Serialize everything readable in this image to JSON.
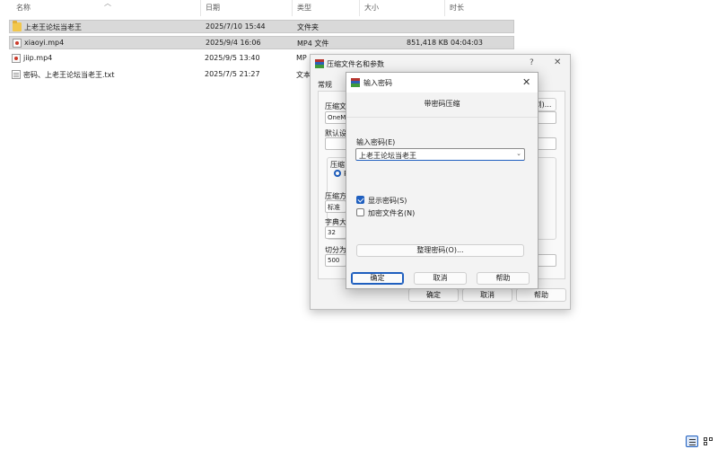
{
  "explorer": {
    "columns": {
      "name": "名称",
      "date": "日期",
      "type": "类型",
      "size": "大小",
      "duration": "时长"
    },
    "files": [
      {
        "name": "上老王论坛当老王",
        "date": "2025/7/10 15:44",
        "type": "文件夹",
        "size": "",
        "duration": "",
        "icon": "folder-icon"
      },
      {
        "name": "xiaoyi.mp4",
        "date": "2025/9/4 16:06",
        "type": "MP4 文件",
        "size": "851,418 KB",
        "duration": "04:04:03",
        "icon": "video-file-icon"
      },
      {
        "name": "jiip.mp4",
        "date": "2025/9/5 13:40",
        "type": "MP",
        "size": "",
        "duration": "",
        "icon": "video-file-icon"
      },
      {
        "name": "密码、上老王论坛当老王.txt",
        "date": "2025/7/5 21:27",
        "type": "文本",
        "size": "",
        "duration": "",
        "icon": "text-file-icon"
      }
    ]
  },
  "archive_dialog": {
    "title": "压缩文件名和参数",
    "help": "?",
    "close": "✕",
    "tab_general": "常规",
    "archive_name_label": "压缩文",
    "archive_name_value": "OneMo",
    "browse_button": "浏)...",
    "default_label": "默认设",
    "format_group_label": "压缩",
    "format_radio_value": "R",
    "method_label": "压缩方",
    "method_value": "标准",
    "dict_label": "字典大",
    "dict_value": "32",
    "split_label": "切分为",
    "split_value": "500",
    "ok_button": "确定",
    "cancel_button": "取消",
    "help_button": "帮助"
  },
  "password_dialog": {
    "title": "输入密码",
    "close": "✕",
    "subtitle": "带密码压缩",
    "password_label": "输入密码(E)",
    "password_value": "上老王论坛当老王",
    "dropdown_arrow": "⌄",
    "show_password_label": "显示密码(S)",
    "show_password_checked": true,
    "encrypt_names_label": "加密文件名(N)",
    "encrypt_names_checked": false,
    "organize_button": "整理密码(O)...",
    "ok_button": "确定",
    "cancel_button": "取消",
    "help_button": "帮助"
  }
}
